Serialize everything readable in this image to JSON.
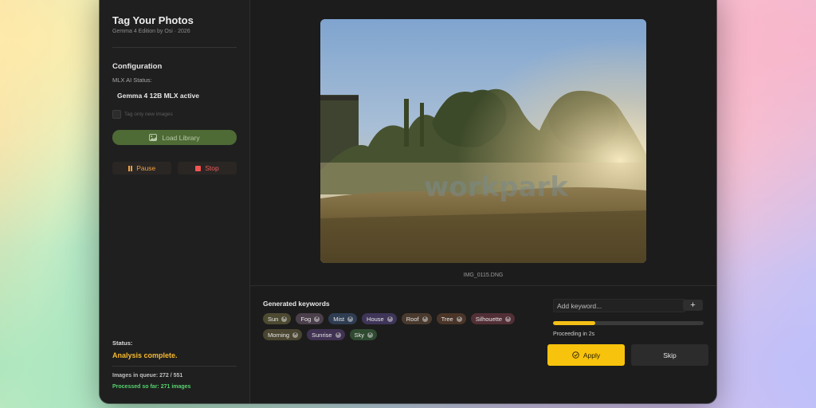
{
  "app": {
    "title": "Tag Your Photos",
    "subtitle": "Gemma 4 Edition by Osi · 2026"
  },
  "sidebar": {
    "config_heading": "Configuration",
    "mlx_label": "MLX AI Status:",
    "mlx_value": "Gemma 4 12B MLX active",
    "checkbox_label": "Tag only new images",
    "checkbox_checked": false,
    "load_label": "Load Library",
    "pause_label": "Pause",
    "stop_label": "Stop",
    "status_label": "Status:",
    "status_value": "Analysis complete.",
    "queue_text": "Images in queue: 272 / 551",
    "processed_text": "Processed so far: 271 images"
  },
  "preview": {
    "filename": "IMG_0115.DNG",
    "watermark": "workpark"
  },
  "keywords": {
    "heading": "Generated keywords",
    "tags": [
      {
        "label": "Sun",
        "color": "#4d4a32"
      },
      {
        "label": "Fog",
        "color": "#4a3f4a"
      },
      {
        "label": "Mist",
        "color": "#2f3d52"
      },
      {
        "label": "House",
        "color": "#3e3558"
      },
      {
        "label": "Roof",
        "color": "#4a3a2e"
      },
      {
        "label": "Tree",
        "color": "#4a3528"
      },
      {
        "label": "Silhouette",
        "color": "#522f36"
      },
      {
        "label": "Morning",
        "color": "#4a4530"
      },
      {
        "label": "Sunrise",
        "color": "#403252"
      },
      {
        "label": "Sky",
        "color": "#2f4a30"
      }
    ],
    "add_placeholder": "Add keyword...",
    "add_button": "+"
  },
  "progress": {
    "fraction": 0.28,
    "text": "Proceeding in 2s"
  },
  "actions": {
    "apply_label": "Apply",
    "skip_label": "Skip"
  },
  "icons": {
    "load": "photo-library-icon",
    "pause": "pause-icon",
    "stop": "stop-icon",
    "apply": "check-circle-icon",
    "tag_remove": "close-circle-icon"
  },
  "colors": {
    "accent_yellow": "#f8c30c",
    "status_orange": "#f6b92e",
    "processed_green": "#56d26e",
    "load_green": "#4e6a35",
    "pause_orange": "#f0a040",
    "stop_red": "#f05a5a"
  }
}
